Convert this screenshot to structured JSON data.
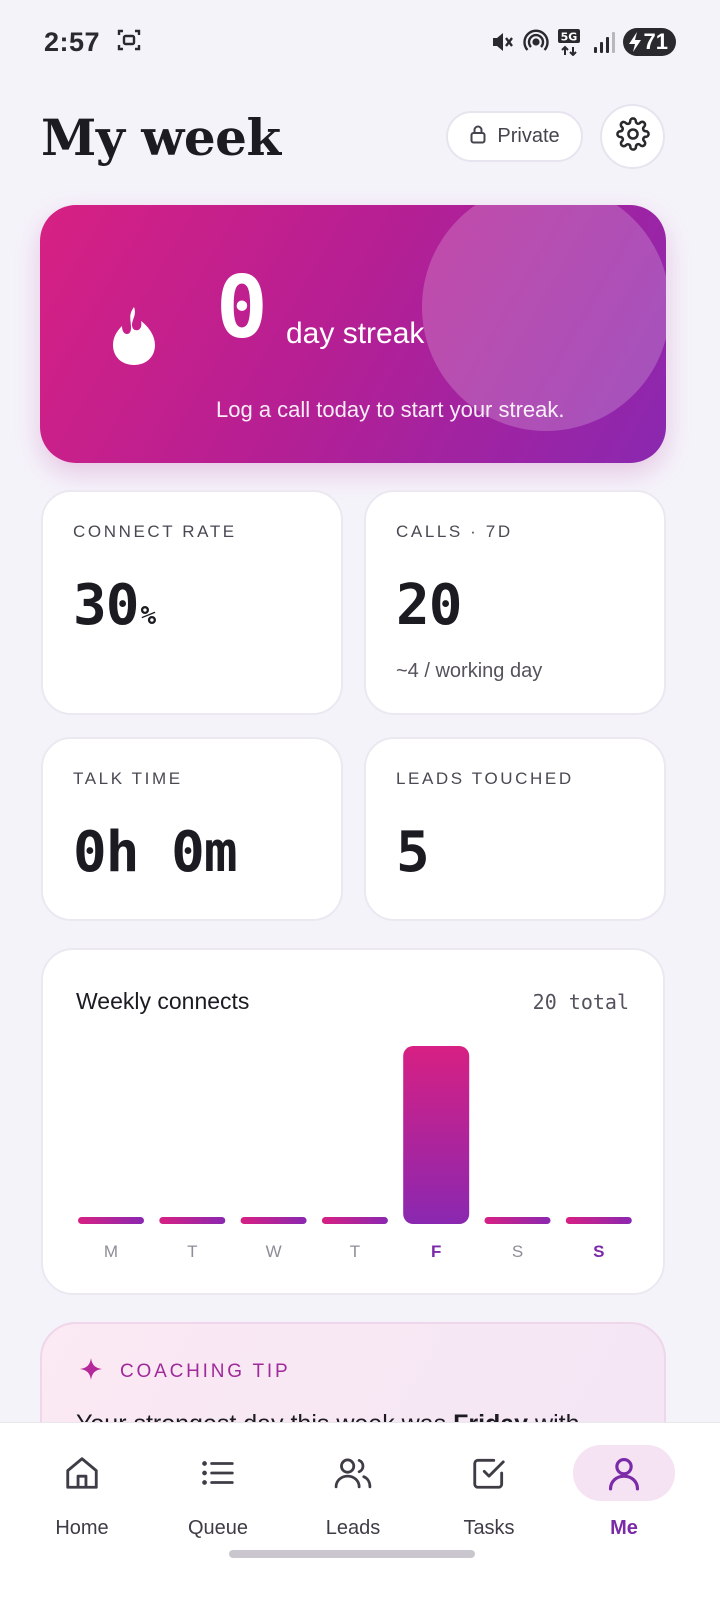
{
  "status_bar": {
    "time": "2:57",
    "battery": "71",
    "network": "5G"
  },
  "header": {
    "title": "My week",
    "private_label": "Private"
  },
  "streak": {
    "count": "0",
    "label": "day streak",
    "subtext": "Log a call today to start your streak."
  },
  "stats": {
    "connect_rate": {
      "label": "CONNECT RATE",
      "value": "30",
      "unit": "%"
    },
    "calls": {
      "label": "CALLS · 7D",
      "value": "20",
      "subtext": "~4 / working day"
    },
    "talk_time": {
      "label": "TALK TIME",
      "value": "0h 0m"
    },
    "leads_touched": {
      "label": "LEADS TOUCHED",
      "value": "5"
    }
  },
  "weekly_connects": {
    "title": "Weekly connects",
    "total_label": "20 total"
  },
  "chart_data": {
    "type": "bar",
    "title": "Weekly connects",
    "categories": [
      "M",
      "T",
      "W",
      "T",
      "F",
      "S",
      "S"
    ],
    "values": [
      0,
      0,
      0,
      0,
      20,
      0,
      0
    ],
    "highlighted": [
      4,
      6
    ],
    "colors": {
      "gradient_start": "#d72083",
      "gradient_end": "#8a28b0",
      "label": "#8f8c97",
      "label_active": "#7b2aa8"
    }
  },
  "coaching_tip": {
    "label": "COACHING TIP",
    "text_prefix": "Your strongest day this week was ",
    "text_bold": "Friday",
    "text_suffix": " with"
  },
  "bottom_nav": {
    "items": [
      {
        "label": "Home",
        "icon": "home-icon"
      },
      {
        "label": "Queue",
        "icon": "list-icon"
      },
      {
        "label": "Leads",
        "icon": "users-icon"
      },
      {
        "label": "Tasks",
        "icon": "checkbox-icon"
      },
      {
        "label": "Me",
        "icon": "person-icon",
        "active": true
      }
    ]
  },
  "colors": {
    "accent": "#7b2aa8",
    "brand_pink": "#d72083",
    "background": "#f5f3fa"
  }
}
